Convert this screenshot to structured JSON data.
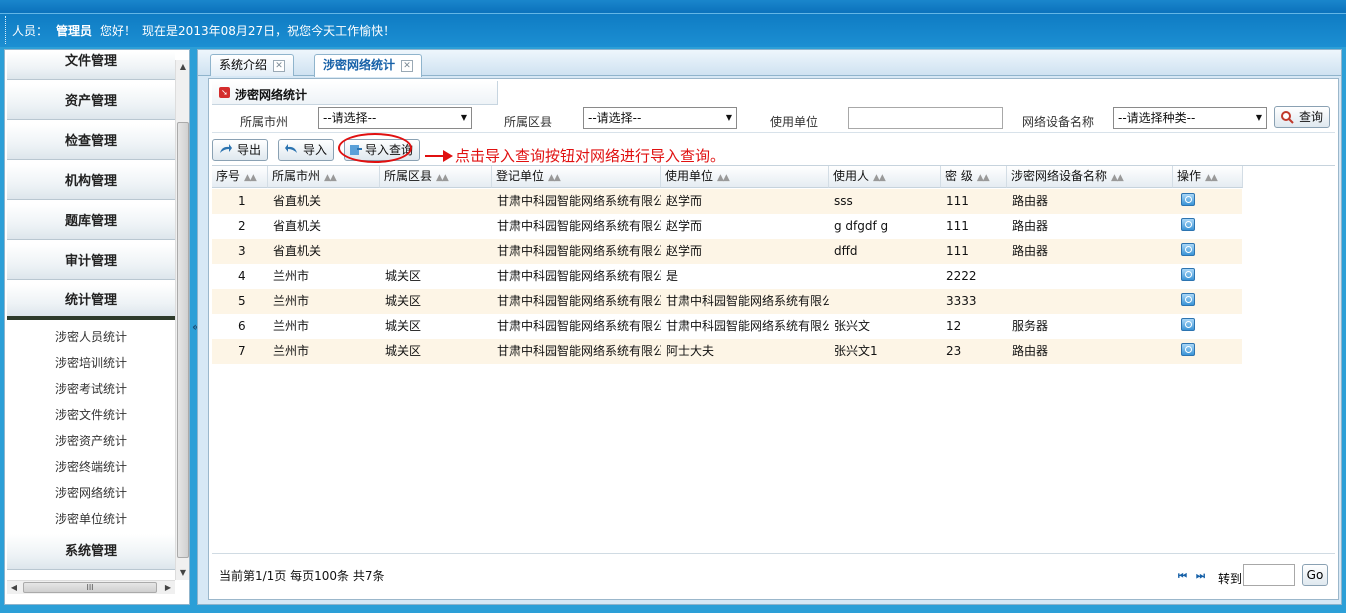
{
  "header": {
    "role_label": "人员：",
    "user_name": "管理员",
    "greeting": "您好！",
    "date_text": "现在是2013年08月27日，祝您今天工作愉快！"
  },
  "sidebar": {
    "menu": [
      {
        "label": "文件管理"
      },
      {
        "label": "资产管理"
      },
      {
        "label": "检查管理"
      },
      {
        "label": "机构管理"
      },
      {
        "label": "题库管理"
      },
      {
        "label": "审计管理"
      },
      {
        "label": "统计管理"
      }
    ],
    "sub_items": [
      {
        "label": "涉密人员统计"
      },
      {
        "label": "涉密培训统计"
      },
      {
        "label": "涉密考试统计"
      },
      {
        "label": "涉密文件统计"
      },
      {
        "label": "涉密资产统计"
      },
      {
        "label": "涉密终端统计"
      },
      {
        "label": "涉密网络统计"
      },
      {
        "label": "涉密单位统计"
      }
    ],
    "bottom_menu": {
      "label": "系统管理"
    },
    "hscroll_grip": "III",
    "collapse_glyph": "«"
  },
  "tabs": [
    {
      "label": "系统介绍",
      "active": false
    },
    {
      "label": "涉密网络统计",
      "active": true
    }
  ],
  "panel": {
    "title": "涉密网络统计"
  },
  "filters": {
    "city_label": "所属市州",
    "city_value": "--请选择--",
    "district_label": "所属区县",
    "district_value": "--请选择--",
    "unit_label": "使用单位",
    "unit_value": "",
    "device_label": "网络设备名称",
    "device_value": "--请选择种类--",
    "query_button": "查询"
  },
  "toolbar": {
    "export_label": "导出",
    "import_label": "导入",
    "import_query_label": "导入查询",
    "annotation": "点击导入查询按钮对网络进行导入查询。"
  },
  "table": {
    "columns": [
      "序号",
      "所属市州",
      "所属区县",
      "登记单位",
      "使用单位",
      "使用人",
      "密 级",
      "涉密网络设备名称",
      "操作"
    ],
    "rows": [
      {
        "no": "1",
        "city": "省直机关",
        "district": "",
        "reg_unit": "甘肃中科园智能网络系统有限公",
        "use_unit": "赵学而",
        "user": "sss",
        "level": "111",
        "device": "路由器"
      },
      {
        "no": "2",
        "city": "省直机关",
        "district": "",
        "reg_unit": "甘肃中科园智能网络系统有限公",
        "use_unit": "赵学而",
        "user": "g dfgdf g",
        "level": "111",
        "device": "路由器"
      },
      {
        "no": "3",
        "city": "省直机关",
        "district": "",
        "reg_unit": "甘肃中科园智能网络系统有限公",
        "use_unit": "赵学而",
        "user": "dffd",
        "level": "111",
        "device": "路由器"
      },
      {
        "no": "4",
        "city": "兰州市",
        "district": "城关区",
        "reg_unit": "甘肃中科园智能网络系统有限公",
        "use_unit": "是",
        "user": "",
        "level": "2222",
        "device": ""
      },
      {
        "no": "5",
        "city": "兰州市",
        "district": "城关区",
        "reg_unit": "甘肃中科园智能网络系统有限公",
        "use_unit": "甘肃中科园智能网络系统有限公",
        "user": "",
        "level": "3333",
        "device": ""
      },
      {
        "no": "6",
        "city": "兰州市",
        "district": "城关区",
        "reg_unit": "甘肃中科园智能网络系统有限公",
        "use_unit": "甘肃中科园智能网络系统有限公",
        "user": "张兴文",
        "level": "12",
        "device": "服务器"
      },
      {
        "no": "7",
        "city": "兰州市",
        "district": "城关区",
        "reg_unit": "甘肃中科园智能网络系统有限公",
        "use_unit": "阿士大夫",
        "user": "张兴文1",
        "level": "23",
        "device": "路由器"
      }
    ]
  },
  "pager": {
    "info": "当前第1/1页  每页100条  共7条",
    "first_glyph": "⏮",
    "last_glyph": "⏭",
    "goto_label": "转到",
    "go_button": "Go"
  },
  "colors": {
    "accent": "#1761a8",
    "annotation": "#e01010",
    "row_highlight": "#fdf5e6"
  }
}
